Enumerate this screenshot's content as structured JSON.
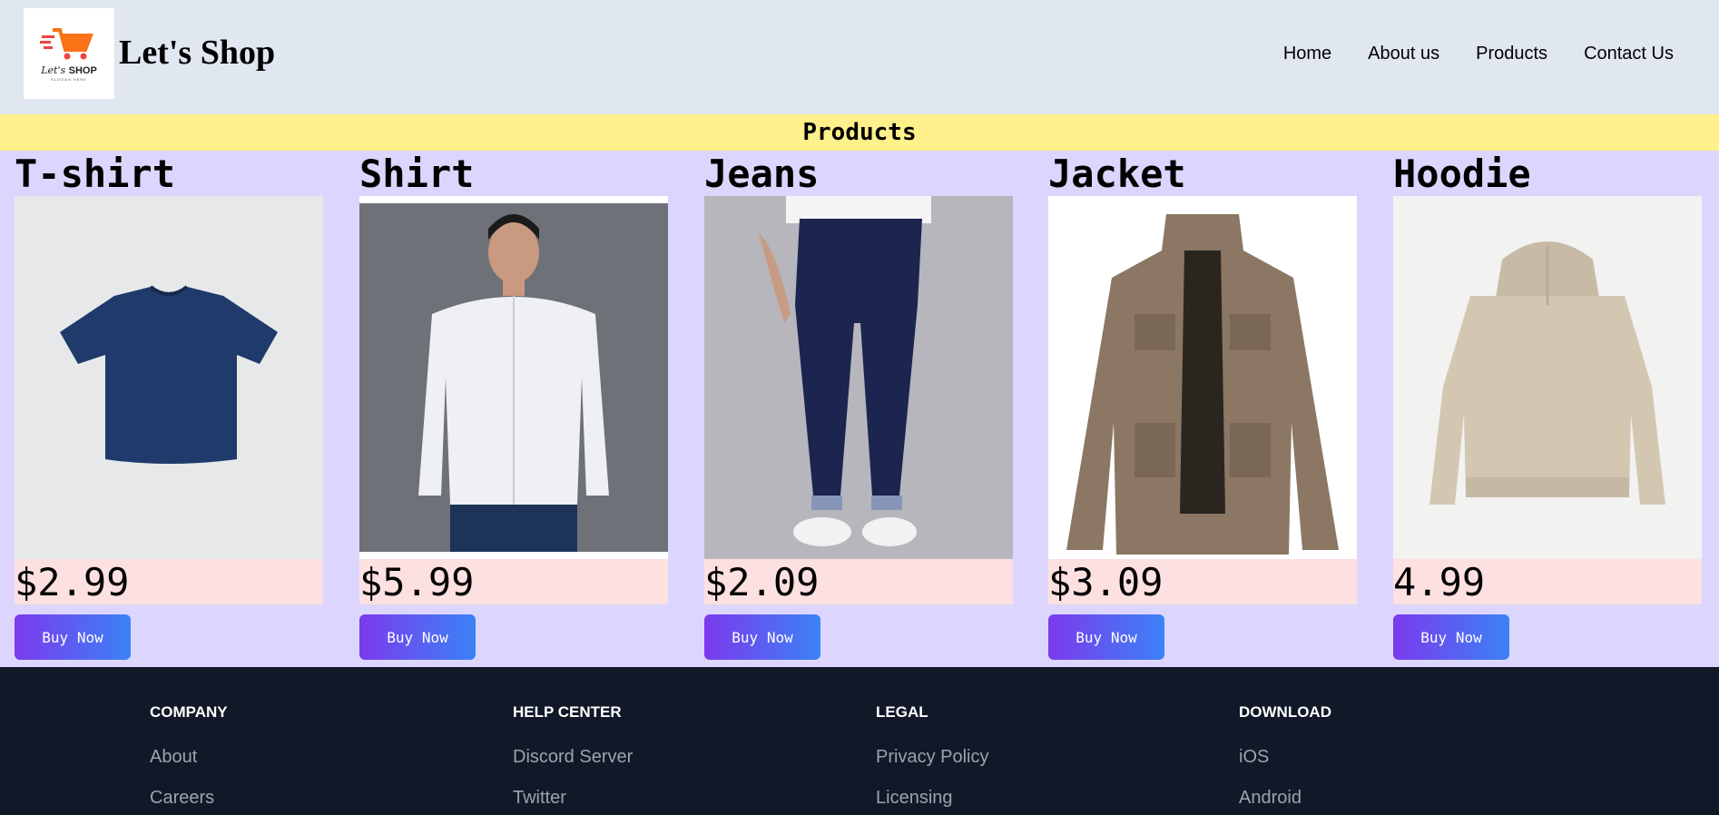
{
  "header": {
    "logo_text_a": "Let's",
    "logo_text_b": "SHOP",
    "logo_slogan": "SLOGAN HERE",
    "brand": "Let's Shop",
    "nav": [
      "Home",
      "About us",
      "Products",
      "Contact Us"
    ]
  },
  "banner": "Products",
  "products": [
    {
      "name": "T-shirt",
      "price": "$2.99",
      "button": "Buy Now",
      "image": "navy-tshirt"
    },
    {
      "name": "Shirt",
      "price": "$5.99",
      "button": "Buy Now",
      "image": "white-shirt-model"
    },
    {
      "name": "Jeans",
      "price": "$2.09",
      "button": "Buy Now",
      "image": "navy-jeans"
    },
    {
      "name": "Jacket",
      "price": "$3.09",
      "button": "Buy Now",
      "image": "khaki-jacket"
    },
    {
      "name": "Hoodie",
      "price": "4.99",
      "button": "Buy Now",
      "image": "beige-hoodie"
    }
  ],
  "footer": {
    "columns": [
      {
        "heading": "COMPANY",
        "links": [
          "About",
          "Careers"
        ]
      },
      {
        "heading": "HELP CENTER",
        "links": [
          "Discord Server",
          "Twitter"
        ]
      },
      {
        "heading": "LEGAL",
        "links": [
          "Privacy Policy",
          "Licensing"
        ]
      },
      {
        "heading": "DOWNLOAD",
        "links": [
          "iOS",
          "Android"
        ]
      }
    ]
  },
  "colors": {
    "header_bg": "#e0e7f1",
    "banner_bg": "#fef08a",
    "page_bg": "#dcd6fe",
    "price_bg": "#fde0e0",
    "button_gradient": [
      "#7c3aed",
      "#3b82f6"
    ],
    "footer_bg": "#111827"
  }
}
